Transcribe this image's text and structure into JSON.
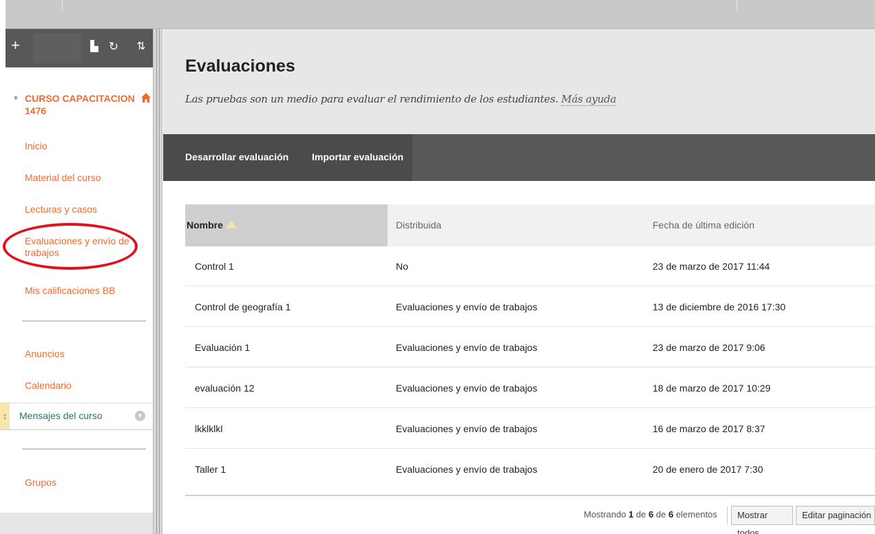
{
  "sidebar": {
    "tools": {
      "add": "+",
      "folder": "▙",
      "refresh": "↻",
      "sort": "⇅"
    },
    "course_title": "CURSO CAPACITACION 1476",
    "items": [
      {
        "label": "Inicio"
      },
      {
        "label": "Material del curso"
      },
      {
        "label": "Lecturas y casos"
      },
      {
        "label": "Evaluaciones y envío de trabajos"
      },
      {
        "label": "Mis calificaciones BB"
      },
      {
        "label": "Anuncios"
      },
      {
        "label": "Calendario"
      },
      {
        "label": "Mensajes del curso"
      },
      {
        "label": "Grupos"
      }
    ],
    "accent": "#f26a2f"
  },
  "header": {
    "title": "Evaluaciones",
    "description": "Las pruebas son un medio para evaluar el rendimiento de los estudiantes.",
    "help_link": "Más ayuda"
  },
  "action_bar": {
    "build": "Desarrollar evaluación",
    "import": "Importar evaluación"
  },
  "table": {
    "columns": [
      "Nombre",
      "Distribuida",
      "Fecha de última edición"
    ],
    "rows": [
      {
        "name": "Control 1",
        "dist": "No",
        "date": "23 de marzo de 2017 11:44"
      },
      {
        "name": "Control de geografía 1",
        "dist": "Evaluaciones y envío de trabajos",
        "date": "13 de diciembre de 2016 17:30"
      },
      {
        "name": "Evaluación 1",
        "dist": "Evaluaciones y envío de trabajos",
        "date": "23 de marzo de 2017 9:06"
      },
      {
        "name": "evaluación 12",
        "dist": "Evaluaciones y envío de trabajos",
        "date": "18 de marzo de 2017 10:29"
      },
      {
        "name": "lkklklkl",
        "dist": "Evaluaciones y envío de trabajos",
        "date": "16 de marzo de 2017 8:37"
      },
      {
        "name": "Taller 1",
        "dist": "Evaluaciones y envío de trabajos",
        "date": "20 de enero de 2017 7:30"
      }
    ]
  },
  "footer": {
    "showing_prefix": "Mostrando",
    "from": "1",
    "de1": "de",
    "to": "6",
    "de2": "de",
    "total": "6",
    "suffix": "elementos",
    "show_all": "Mostrar todos",
    "edit_paging": "Editar paginación ..."
  }
}
